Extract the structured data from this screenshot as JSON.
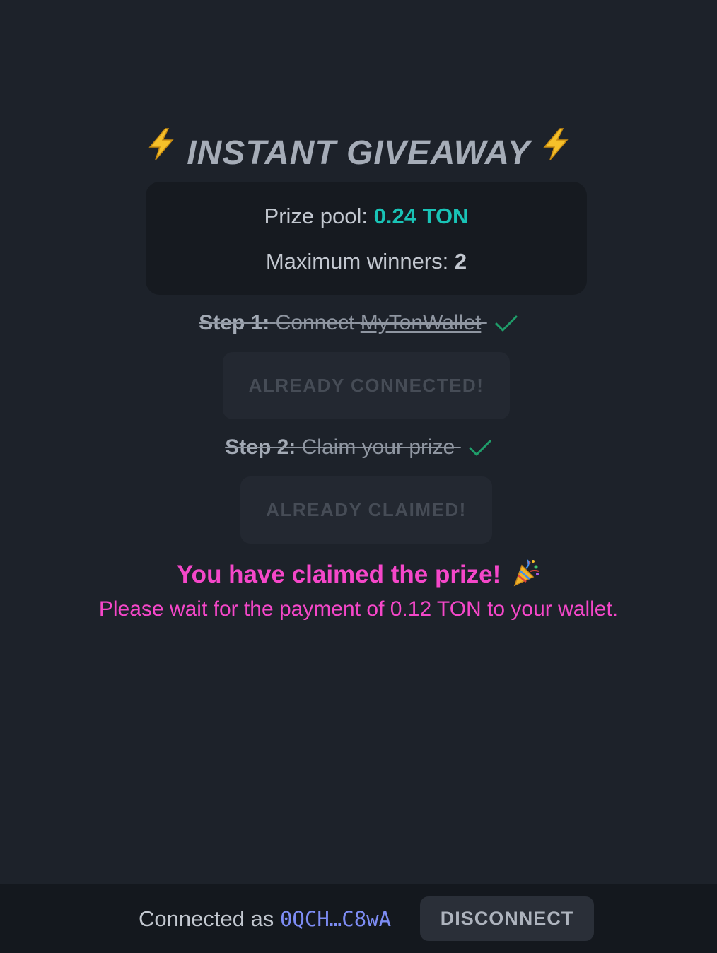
{
  "header": {
    "title": "INSTANT GIVEAWAY",
    "icon": "lightning-icon"
  },
  "stats": {
    "prize_label": "Prize pool:",
    "prize_value": "0.24 TON",
    "winners_label": "Maximum winners:",
    "winners_value": "2"
  },
  "steps": [
    {
      "label": "Step 1:",
      "text": "Connect",
      "link": "MyTonWallet",
      "completed": true,
      "button_label": "ALREADY CONNECTED!"
    },
    {
      "label": "Step 2:",
      "text": "Claim your prize",
      "completed": true,
      "button_label": "ALREADY CLAIMED!"
    }
  ],
  "result": {
    "headline": "You have claimed the prize!",
    "icon": "party-popper-icon",
    "message": "Please wait for the payment of 0.12 TON to your wallet."
  },
  "footer": {
    "connected_label": "Connected as",
    "address": "0QCH…C8wA",
    "disconnect_label": "DISCONNECT"
  },
  "colors": {
    "background": "#1d222a",
    "panel": "#161a20",
    "accent_teal": "#19c3b6",
    "accent_pink": "#f547c9",
    "address_blue": "#7d8cf4",
    "check_green": "#1f9e6a",
    "bolt_yellow": "#f5c02a"
  }
}
